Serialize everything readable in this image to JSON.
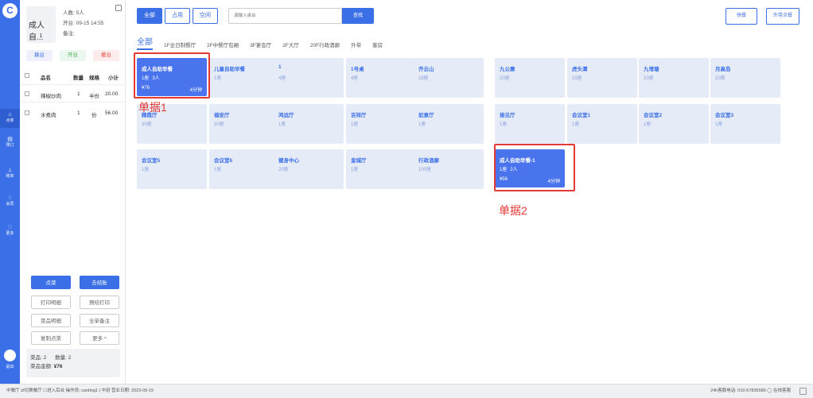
{
  "nav": {
    "logo": "C",
    "items": [
      {
        "label": "点单",
        "icon": "food-icon",
        "glyph": "⌂"
      },
      {
        "label": "预订",
        "icon": "calendar-icon",
        "glyph": "▤"
      },
      {
        "label": "账单",
        "icon": "bill-icon",
        "glyph": "⊥"
      },
      {
        "label": "会员",
        "icon": "member-icon",
        "glyph": "♢"
      },
      {
        "label": "更多",
        "icon": "more-icon",
        "glyph": "∷"
      }
    ],
    "logout": "退出"
  },
  "order": {
    "table_name": "成人自...",
    "table_number": "1",
    "guests": "人数: 5人",
    "open_time": "开台: 09-15 14:55",
    "note": "备注:",
    "buttons": {
      "change": "换台",
      "open": "开台",
      "cancel": "撤台"
    },
    "headers": {
      "name": "品名",
      "qty": "数量",
      "unit": "规格",
      "subtotal": "小计"
    },
    "items": [
      {
        "name": "辣椒炒肉",
        "qty": "1",
        "unit": "半份",
        "subtotal": "20.00"
      },
      {
        "name": "水煮肉",
        "qty": "1",
        "unit": "份",
        "subtotal": "56.00"
      }
    ],
    "actions": {
      "order": "点菜",
      "checkout": "去结账",
      "print_detail": "打印明细",
      "pre_print": "预结打印",
      "dish_detail": "菜品明细",
      "all_note": "全单备注",
      "copy_order": "复制点菜",
      "more": "更多 ^"
    },
    "summary": {
      "dishes": "菜品: 2",
      "quantity": "数量: 2",
      "amount_label": "菜品金额:",
      "amount": "¥76"
    }
  },
  "main": {
    "status_tabs": [
      "全部",
      "占用",
      "空闲"
    ],
    "search_placeholder": "请输入桌台",
    "search_button": "查找",
    "quick_order": "快餐",
    "takeout": "外带点餐",
    "area_tabs": [
      "全部",
      "1F全日制餐厅",
      "2F中餐厅包厢",
      "3F宴会厅",
      "2F大厅",
      "20F行政酒廊",
      "外带",
      "客房"
    ],
    "tables": [
      {
        "name": "成人自助早餐",
        "seats": "1座",
        "guests": "3人",
        "amount": "¥76",
        "time": "4分钟",
        "occupied": true
      },
      {
        "name": "儿童自助早餐",
        "seats": "1座",
        "occupied": false
      },
      {
        "name": "1",
        "seats": "4座",
        "occupied": false
      },
      {
        "name": "1号桌",
        "seats": "4座",
        "occupied": false
      },
      {
        "name": "齐云山",
        "seats": "28座",
        "occupied": false
      },
      {
        "name": "九公寨",
        "seats": "20座",
        "occupied": false
      },
      {
        "name": "虎头潭",
        "seats": "15座",
        "occupied": false
      },
      {
        "name": "九增塘",
        "seats": "20座",
        "occupied": false
      },
      {
        "name": "月高岛",
        "seats": "20座",
        "occupied": false
      },
      {
        "name": "精鼎厅",
        "seats": "30座",
        "occupied": false
      },
      {
        "name": "福安厅",
        "seats": "30座",
        "occupied": false
      },
      {
        "name": "鸿运厅",
        "seats": "1座",
        "occupied": false
      },
      {
        "name": "吉祥厅",
        "seats": "1座",
        "occupied": false
      },
      {
        "name": "如意厅",
        "seats": "1座",
        "occupied": false
      },
      {
        "name": "接见厅",
        "seats": "1座",
        "occupied": false
      },
      {
        "name": "会议室1",
        "seats": "1座",
        "occupied": false
      },
      {
        "name": "会议室2",
        "seats": "1座",
        "occupied": false
      },
      {
        "name": "会议室3",
        "seats": "1座",
        "occupied": false
      },
      {
        "name": "会议室5",
        "seats": "1座",
        "occupied": false
      },
      {
        "name": "会议室6",
        "seats": "1座",
        "occupied": false
      },
      {
        "name": "健身中心",
        "seats": "20座",
        "occupied": false
      },
      {
        "name": "皇城厅",
        "seats": "1座",
        "occupied": false
      },
      {
        "name": "行政酒廊",
        "seats": "100座",
        "occupied": false
      },
      {
        "name": "成人自助早餐-1",
        "seats": "1座",
        "guests": "2人",
        "amount": "¥56",
        "time": "4分钟",
        "occupied": true
      }
    ],
    "annotations": [
      "单据1",
      "单据2"
    ]
  },
  "footer": {
    "left": "中餐厅  ⇄切换餐厅   ☐进入后台   操作员: canting1   |   中班   营业日期: 2023-09-15",
    "right": "24h客服电话: 010-57835586   ◯ 在线客服"
  },
  "colors": {
    "primary": "#3a6fe8",
    "annotation": "#e53935"
  }
}
